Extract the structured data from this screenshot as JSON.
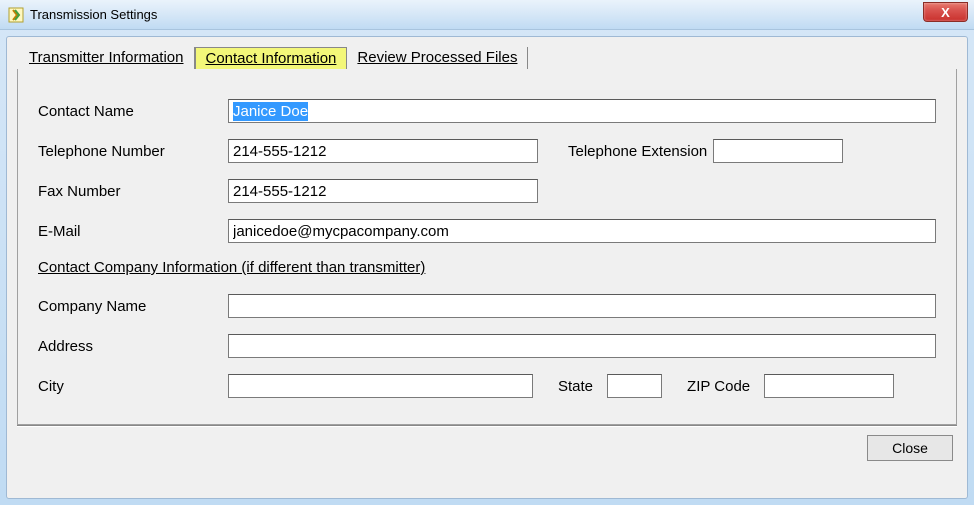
{
  "window": {
    "title": "Transmission Settings",
    "close_glyph": "X"
  },
  "tabs": {
    "transmitter": "Transmitter Information",
    "contact": "Contact Information",
    "review": "Review Processed Files",
    "active": "contact"
  },
  "form": {
    "contact_name_label": "Contact Name",
    "contact_name": "Janice Doe",
    "telephone_label": "Telephone Number",
    "telephone": "214-555-1212",
    "extension_label": "Telephone Extension",
    "extension": "",
    "fax_label": "Fax Number",
    "fax": "214-555-1212",
    "email_label": "E-Mail",
    "email": "janicedoe@mycpacompany.com",
    "section_header": "Contact Company Information (if different than transmitter)",
    "company_label": "Company Name",
    "company": "",
    "address_label": "Address",
    "address": "",
    "city_label": "City",
    "city": "",
    "state_label": "State",
    "state": "",
    "zip_label": "ZIP Code",
    "zip": ""
  },
  "buttons": {
    "close": "Close"
  }
}
